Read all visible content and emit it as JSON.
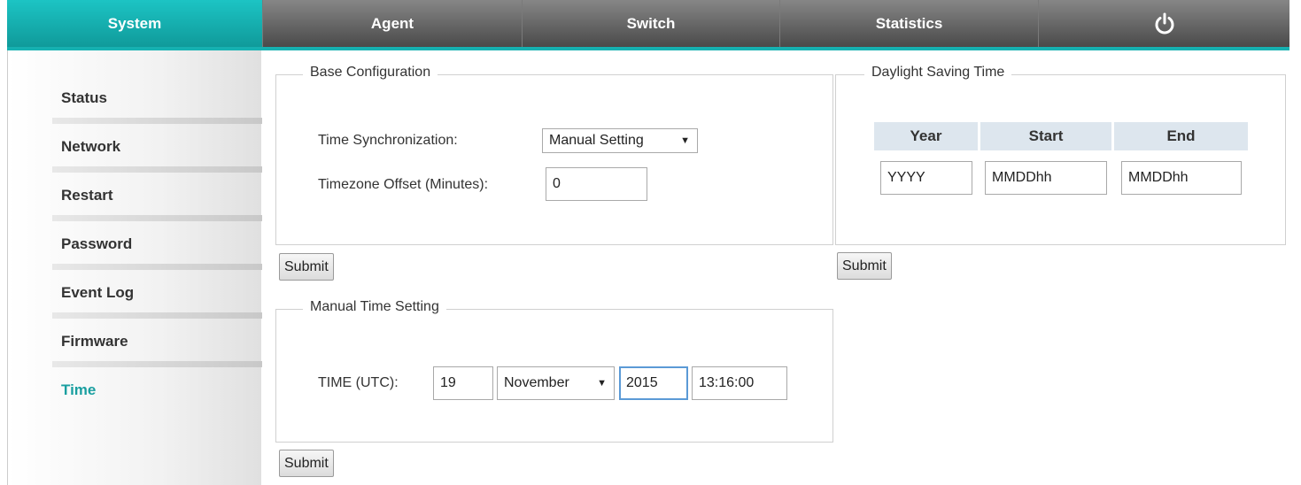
{
  "nav": {
    "tabs": [
      {
        "label": "System"
      },
      {
        "label": "Agent"
      },
      {
        "label": "Switch"
      },
      {
        "label": "Statistics"
      }
    ]
  },
  "sidebar": {
    "items": [
      {
        "label": "Status"
      },
      {
        "label": "Network"
      },
      {
        "label": "Restart"
      },
      {
        "label": "Password"
      },
      {
        "label": "Event Log"
      },
      {
        "label": "Firmware"
      },
      {
        "label": "Time"
      }
    ]
  },
  "base_config": {
    "legend": "Base Configuration",
    "time_sync_label": "Time Synchronization:",
    "time_sync_value": "Manual Setting",
    "tz_offset_label": "Timezone Offset (Minutes):",
    "tz_offset_value": "0",
    "submit": "Submit"
  },
  "dst": {
    "legend": "Daylight Saving Time",
    "col_year": "Year",
    "col_start": "Start",
    "col_end": "End",
    "year_value": "YYYY",
    "start_value": "MMDDhh",
    "end_value": "MMDDhh",
    "submit": "Submit"
  },
  "manual_time": {
    "legend": "Manual Time Setting",
    "time_label": "TIME (UTC):",
    "day": "19",
    "month": "November",
    "year": "2015",
    "clock": "13:16:00",
    "submit": "Submit"
  },
  "colors": {
    "accent": "#16b1b1",
    "active_sidebar": "#1a9fa0"
  },
  "icons": {
    "power": "power-icon"
  }
}
